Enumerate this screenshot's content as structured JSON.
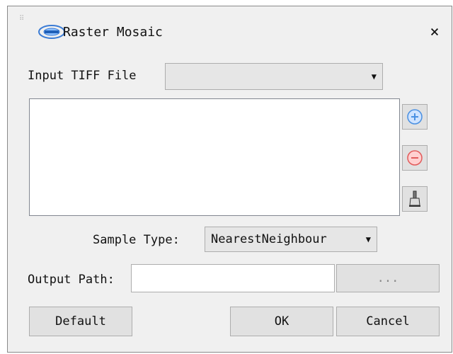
{
  "window": {
    "title": "Raster Mosaic",
    "close_label": "×"
  },
  "input": {
    "label": "Input TIFF File",
    "value": "",
    "files": []
  },
  "buttons_side": {
    "add_icon": "plus-circle-icon",
    "remove_icon": "minus-circle-icon",
    "clear_icon": "brush-icon"
  },
  "sample": {
    "label": "Sample Type:",
    "value": "NearestNeighbour"
  },
  "output": {
    "label": "Output Path:",
    "value": "",
    "browse_label": "..."
  },
  "footer": {
    "default_label": "Default",
    "ok_label": "OK",
    "cancel_label": "Cancel"
  },
  "colors": {
    "add": "#4a90e2",
    "remove": "#e25b5b"
  }
}
